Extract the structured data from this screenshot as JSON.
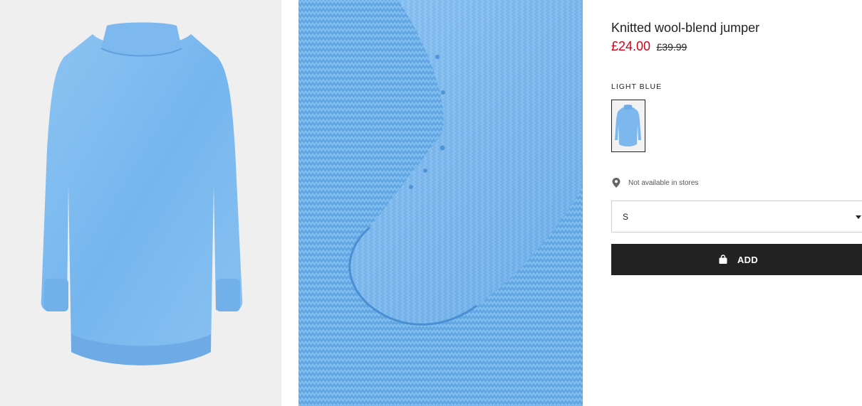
{
  "product": {
    "title": "Knitted wool-blend jumper",
    "sale_price": "£24.00",
    "original_price": "£39.99",
    "sale_color": "#d0021b"
  },
  "images": [
    {
      "kind": "front",
      "icon": "jumper-front-photo"
    },
    {
      "kind": "detail",
      "icon": "sleeve-cuff-detail-photo"
    }
  ],
  "color": {
    "label": "LIGHT BLUE",
    "swatch_color": "#7cb8ee",
    "swatches": [
      {
        "selected": true
      }
    ]
  },
  "availability": {
    "icon": "location-pin-icon",
    "text": "Not available in stores"
  },
  "size_select": {
    "value": "S"
  },
  "add_button": {
    "label": "ADD",
    "icon": "shopping-bag-icon",
    "background": "#222222"
  }
}
